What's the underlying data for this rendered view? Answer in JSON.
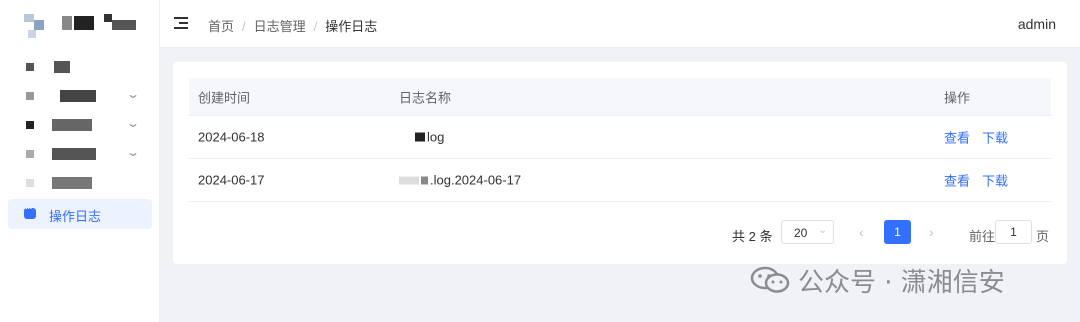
{
  "breadcrumb": {
    "home": "首页",
    "section": "日志管理",
    "current": "操作日志"
  },
  "header": {
    "user": "admin"
  },
  "sidebar": {
    "active_item": "操作日志"
  },
  "table": {
    "columns": [
      "创建时间",
      "日志名称",
      "操作"
    ],
    "rows": [
      {
        "created": "2024-06-18",
        "name": "log",
        "actions": [
          "查看",
          "下载"
        ]
      },
      {
        "created": "2024-06-17",
        "name": ".log.2024-06-17",
        "actions": [
          "查看",
          "下载"
        ]
      }
    ]
  },
  "pagination": {
    "total_prefix": "共",
    "total": "2",
    "total_suffix": "条",
    "page_size": "20",
    "current_page": "1",
    "goto_label": "前往",
    "goto_value": "1",
    "goto_suffix": "页"
  },
  "watermark": {
    "text": "公众号 · 潇湘信安"
  },
  "colors": {
    "primary": "#3370ff",
    "background": "#f0f2f5"
  }
}
